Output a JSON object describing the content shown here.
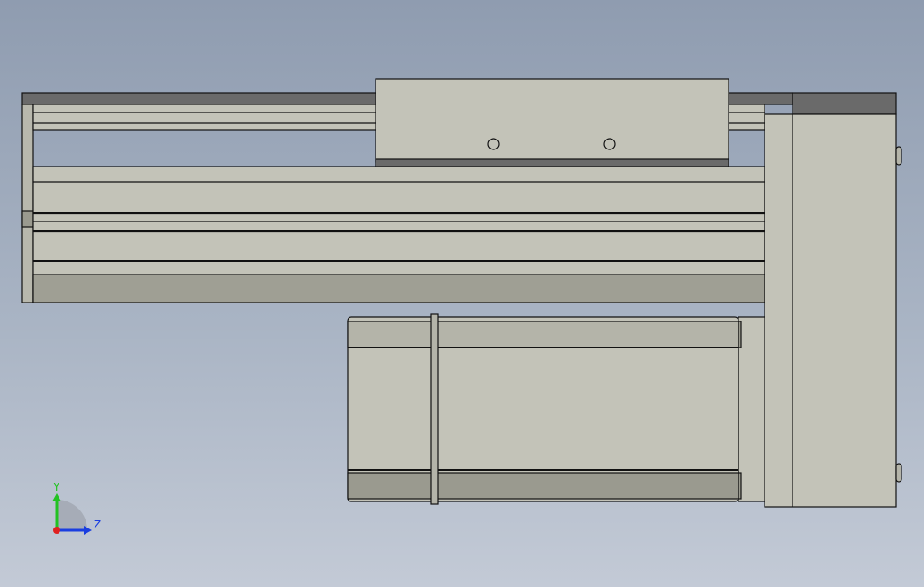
{
  "viewport": {
    "colors": {
      "background_top": "#8f9cb0",
      "background_bottom": "#c3cad6",
      "part_light": "#c3c3b8",
      "part_mid": "#b4b4a9",
      "part_shadow": "#9a9a8f",
      "part_dark": "#6a6a6a",
      "edge": "#101010"
    }
  },
  "triad": {
    "y_label": "Y",
    "z_label": "Z",
    "y_color": "#22c222",
    "z_color": "#1a3ee0",
    "x_color": "#e02020"
  }
}
